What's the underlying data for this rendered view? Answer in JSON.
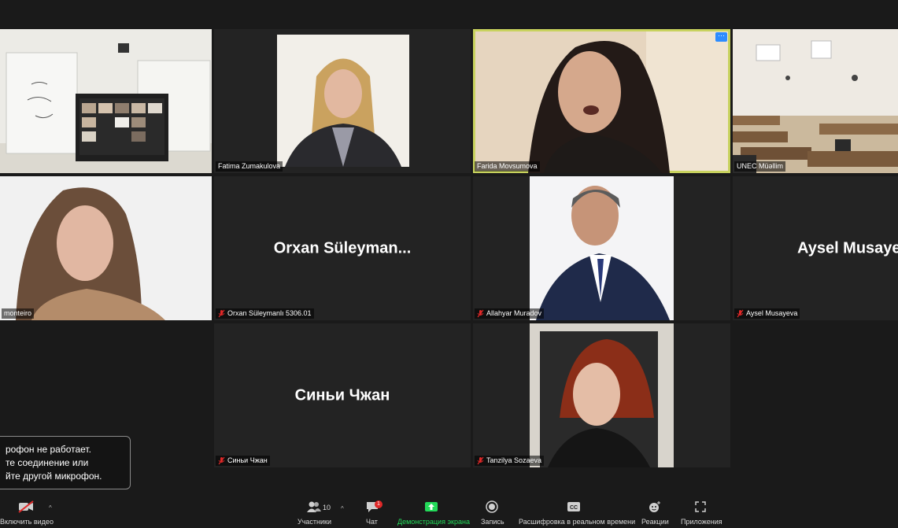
{
  "participants": [
    {
      "id": "classroom",
      "name": "",
      "muted": false
    },
    {
      "id": "fatima",
      "name": "Fatima Zumakulova",
      "muted": false
    },
    {
      "id": "farida",
      "name": "Farida Movsumova",
      "muted": false,
      "active": true
    },
    {
      "id": "unec",
      "name": "UNEC Müəllim",
      "muted": false
    },
    {
      "id": "monteiro",
      "name": "monteiro",
      "muted": false
    },
    {
      "id": "orxan",
      "name": "Orxan Süleymanlı 5306.01",
      "display_name": "Orxan  Süleyman...",
      "muted": true
    },
    {
      "id": "allahyar",
      "name": "Allahyar Muradov",
      "muted": true
    },
    {
      "id": "aysel",
      "name": "Aysel Musayeva",
      "display_name": "Aysel Musaye",
      "muted": true
    },
    {
      "id": "sinyi",
      "name": "Синьи Чжан",
      "display_name": "Синьи Чжан",
      "muted": true
    },
    {
      "id": "tanzilya",
      "name": "Tanzilya Sozaeva",
      "muted": true
    }
  ],
  "toast": {
    "lines": [
      "рофон не работает.",
      "те соединение или",
      "йте другой микрофон."
    ]
  },
  "toolbar": {
    "video_label": "Включить видео",
    "participants_label": "Участники",
    "participants_count": "10",
    "chat_label": "Чат",
    "chat_badge": "1",
    "share_label": "Демонстрация экрана",
    "record_label": "Запись",
    "transcript_label": "Расшифровка в реальном времени",
    "transcript_icon": "CC",
    "reactions_label": "Реакции",
    "apps_label": "Приложения"
  },
  "colors": {
    "active_border": "#c8d25e",
    "share_green": "#23d959",
    "badge_red": "#e02828",
    "muted_red": "#e02828"
  }
}
